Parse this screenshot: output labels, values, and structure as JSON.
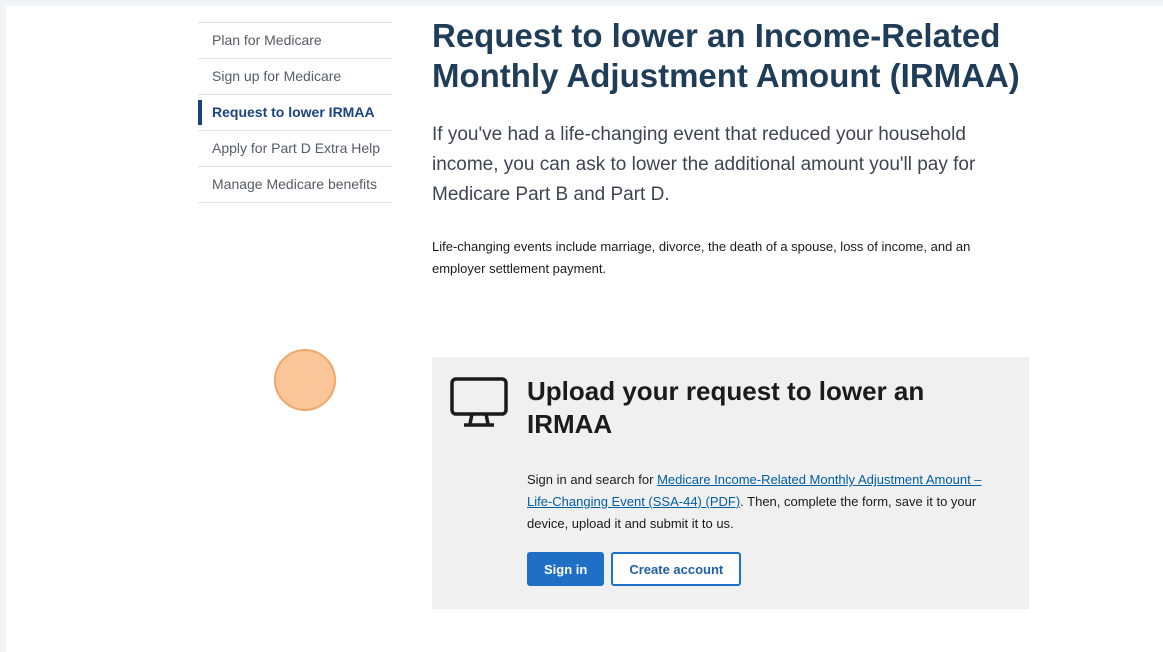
{
  "sidenav": {
    "items": [
      {
        "label": "Plan for Medicare"
      },
      {
        "label": "Sign up for Medicare"
      },
      {
        "label": "Request to lower IRMAA"
      },
      {
        "label": "Apply for Part D Extra Help"
      },
      {
        "label": "Manage Medicare benefits"
      }
    ],
    "active_index": 2
  },
  "main": {
    "title": "Request to lower an Income-Related Monthly Adjustment Amount (IRMAA)",
    "lead": "If you've had a life-changing event that reduced your household income, you can ask to lower the additional amount you'll pay for Medicare Part B and Part D.",
    "body": "Life-changing events include marriage, divorce, the death of a spouse, loss of income, and an employer settlement payment."
  },
  "card": {
    "icon": "computer-monitor-icon",
    "title": "Upload your request to lower an IRMAA",
    "text_before": "Sign in and search for ",
    "link_text": "Medicare Income-Related Monthly Adjustment Amount – Life-Changing Event (SSA-44) (PDF)",
    "text_after": ". Then, complete the form, save it to your device, upload it and submit it to us.",
    "sign_in_label": "Sign in",
    "create_account_label": "Create account"
  },
  "colors": {
    "heading": "#1f3d58",
    "active_nav": "#1a4480",
    "link": "#005ea2",
    "primary_button": "#1f6fc5",
    "card_background": "#f0f0f0",
    "cursor_highlight": "#fabb88"
  }
}
